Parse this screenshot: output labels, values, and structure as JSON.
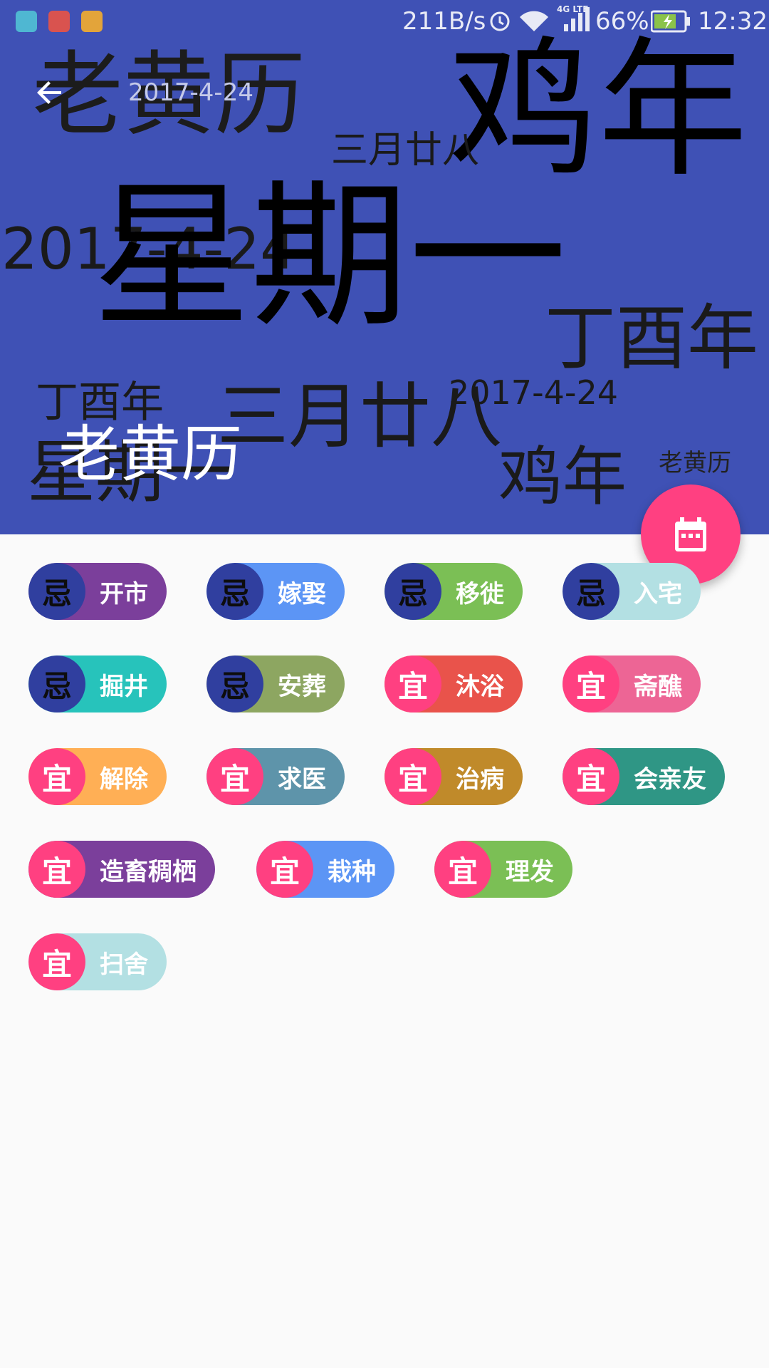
{
  "status_bar": {
    "speed": "211B/s",
    "network": "4G LTE",
    "battery": "66%",
    "time": "12:32",
    "icons": [
      "android-icon",
      "no-disturb-icon",
      "hand-icon",
      "alarm-icon",
      "wifi-icon",
      "signal-icon",
      "battery-icon"
    ]
  },
  "toolbar": {
    "title": "2017-4-24",
    "back_icon": "arrow-back-icon"
  },
  "header": {
    "big_title": "老黄历",
    "accent_color": "#3f51b5",
    "word_cloud": [
      {
        "text": "老黄历"
      },
      {
        "text": "鸡年"
      },
      {
        "text": "三月廿八"
      },
      {
        "text": "2017-4-24"
      },
      {
        "text": "星期一"
      },
      {
        "text": "丁酉年"
      },
      {
        "text": "丁酉年"
      },
      {
        "text": "三月廿八"
      },
      {
        "text": "2017-4-24"
      },
      {
        "text": "星期一"
      },
      {
        "text": "鸡年"
      },
      {
        "text": "老黄历"
      }
    ]
  },
  "fab": {
    "icon": "calendar-icon",
    "color": "#ff4081"
  },
  "chips": [
    {
      "badge": "忌",
      "label": "开市",
      "type": "ji",
      "color": "#7b3f9b"
    },
    {
      "badge": "忌",
      "label": "嫁娶",
      "type": "ji",
      "color": "#5c95f5"
    },
    {
      "badge": "忌",
      "label": "移徙",
      "type": "ji",
      "color": "#7bbf55"
    },
    {
      "badge": "忌",
      "label": "入宅",
      "type": "ji",
      "color": "#b3e0e3"
    },
    {
      "badge": "忌",
      "label": "掘井",
      "type": "ji",
      "color": "#27c3bb"
    },
    {
      "badge": "忌",
      "label": "安葬",
      "type": "ji",
      "color": "#8da661"
    },
    {
      "badge": "宜",
      "label": "沐浴",
      "type": "yi",
      "color": "#e9534b"
    },
    {
      "badge": "宜",
      "label": "斋醮",
      "type": "yi",
      "color": "#ed6595"
    },
    {
      "badge": "宜",
      "label": "解除",
      "type": "yi",
      "color": "#ffaf55"
    },
    {
      "badge": "宜",
      "label": "求医",
      "type": "yi",
      "color": "#5e94aa"
    },
    {
      "badge": "宜",
      "label": "治病",
      "type": "yi",
      "color": "#c08a2a"
    },
    {
      "badge": "宜",
      "label": "会亲友",
      "type": "yi",
      "color": "#2f9685"
    },
    {
      "badge": "宜",
      "label": "造畜稠栖",
      "type": "yi",
      "color": "#7b3f9b"
    },
    {
      "badge": "宜",
      "label": "栽种",
      "type": "yi",
      "color": "#5c95f5"
    },
    {
      "badge": "宜",
      "label": "理发",
      "type": "yi",
      "color": "#7bbf55"
    },
    {
      "badge": "宜",
      "label": "扫舍",
      "type": "yi",
      "color": "#b3e0e3"
    }
  ]
}
